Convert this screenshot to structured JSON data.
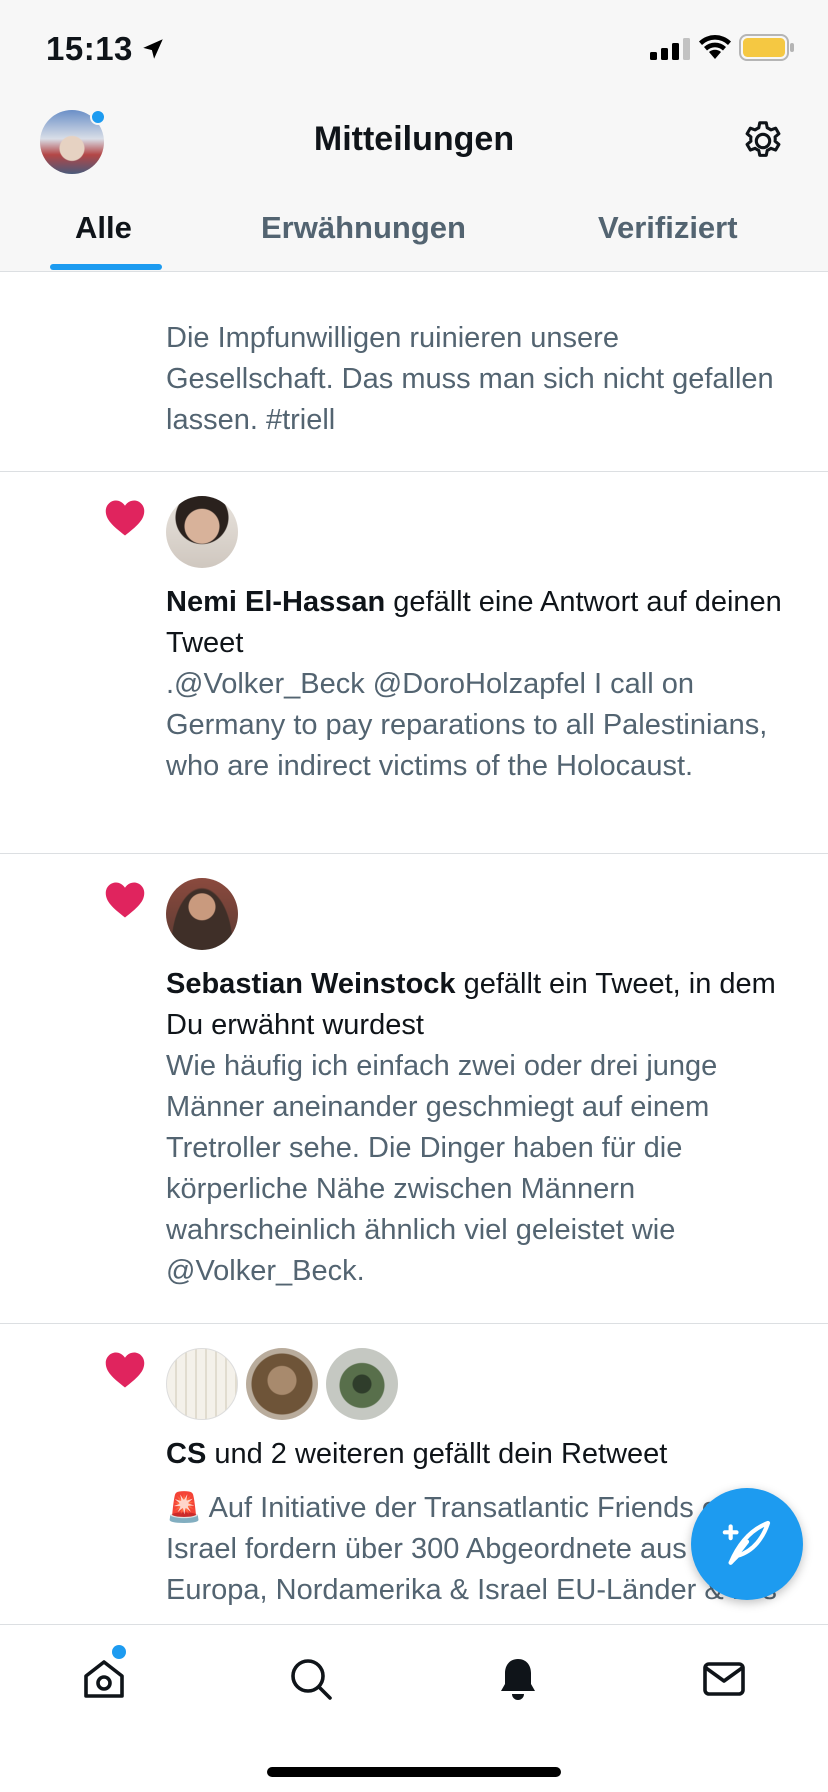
{
  "status_bar": {
    "time": "15:13",
    "icons": [
      "location-arrow-icon",
      "cellular-signal-icon",
      "wifi-icon",
      "battery-icon"
    ],
    "battery_color": "#f5c842"
  },
  "header": {
    "title": "Mitteilungen",
    "icons": [
      "profile-avatar",
      "gear-icon"
    ],
    "tabs": [
      {
        "label": "Alle",
        "active": true
      },
      {
        "label": "Erwähnungen",
        "active": false
      },
      {
        "label": "Verifiziert",
        "active": false
      }
    ]
  },
  "colors": {
    "accent": "#1d9bf0",
    "like": "#e0245e",
    "secondary_text": "#536471",
    "primary_text": "#0f1419"
  },
  "notifications": [
    {
      "type": "partial",
      "body": "Die Impfunwilligen ruinieren unsere Gesellschaft. Das muss man sich nicht gefallen lassen. #triell"
    },
    {
      "type": "like",
      "icon": "heart-icon",
      "actor": "Nemi El-Hassan",
      "action": " gefällt eine Antwort auf deinen Tweet",
      "body": ".@Volker_Beck @DoroHolzapfel I call on Germany to pay reparations to all Palestinians, who are indirect victims of the Holocaust."
    },
    {
      "type": "like",
      "icon": "heart-icon",
      "actor": "Sebastian Weinstock",
      "action": " gefällt ein Tweet, in dem Du erwähnt wurdest",
      "body": "Wie häufig ich einfach zwei oder drei junge Männer aneinander geschmiegt auf einem Tretroller sehe. Die Dinger haben für die körperliche Nähe zwischen Männern wahrscheinlich ähnlich viel geleistet wie @Volker_Beck."
    },
    {
      "type": "like",
      "icon": "heart-icon",
      "actor": "CS",
      "action": " und 2 weiteren gefällt dein Retweet",
      "body_icon": "🚨",
      "body": "Auf Initiative der Transatlantic Friends of Israel fordern über 300 Abgeordnete aus Europa, Nordamerika & Israel EU-Länder & Drs"
    }
  ],
  "fab": {
    "icon": "compose-tweet-icon"
  },
  "tabbar": {
    "items": [
      {
        "icon": "home-icon",
        "has_dot": true
      },
      {
        "icon": "search-icon"
      },
      {
        "icon": "bell-icon",
        "active": true
      },
      {
        "icon": "mail-icon"
      }
    ]
  }
}
